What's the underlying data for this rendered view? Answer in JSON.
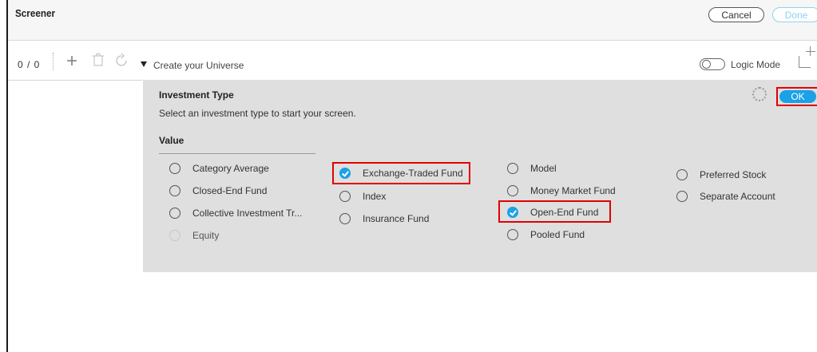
{
  "window": {
    "title": "Screener",
    "cancel_label": "Cancel",
    "done_label": "Done"
  },
  "toolbar": {
    "counter": "0 / 0",
    "universe_label": "Create your Universe",
    "logic_mode_label": "Logic Mode"
  },
  "panel": {
    "title": "Investment Type",
    "subtitle": "Select an investment type to start your screen.",
    "value_label": "Value",
    "ok_label": "OK",
    "options": [
      {
        "label": "Category Average",
        "checked": false,
        "disabled": false
      },
      {
        "label": "Closed-End Fund",
        "checked": false,
        "disabled": false
      },
      {
        "label": "Collective Investment Tr...",
        "checked": false,
        "disabled": false
      },
      {
        "label": "Equity",
        "checked": false,
        "disabled": true
      },
      {
        "label": "Exchange-Traded Fund",
        "checked": true,
        "disabled": false
      },
      {
        "label": "Index",
        "checked": false,
        "disabled": false
      },
      {
        "label": "Insurance Fund",
        "checked": false,
        "disabled": false
      },
      {
        "label": "Model",
        "checked": false,
        "disabled": false
      },
      {
        "label": "Money Market Fund",
        "checked": false,
        "disabled": false
      },
      {
        "label": "Open-End Fund",
        "checked": true,
        "disabled": false
      },
      {
        "label": "Pooled Fund",
        "checked": false,
        "disabled": false
      },
      {
        "label": "Preferred Stock",
        "checked": false,
        "disabled": false
      },
      {
        "label": "Separate Account",
        "checked": false,
        "disabled": false
      }
    ]
  },
  "icons": [
    "add-icon",
    "delete-icon",
    "redo-icon",
    "expand-triangle-icon",
    "toggle-icon",
    "add-level-icon",
    "settings-gear-icon",
    "check-icon"
  ],
  "colors": {
    "accent": "#1aa1e8",
    "highlight": "#e30000",
    "panel_bg": "#dfdfdf"
  }
}
